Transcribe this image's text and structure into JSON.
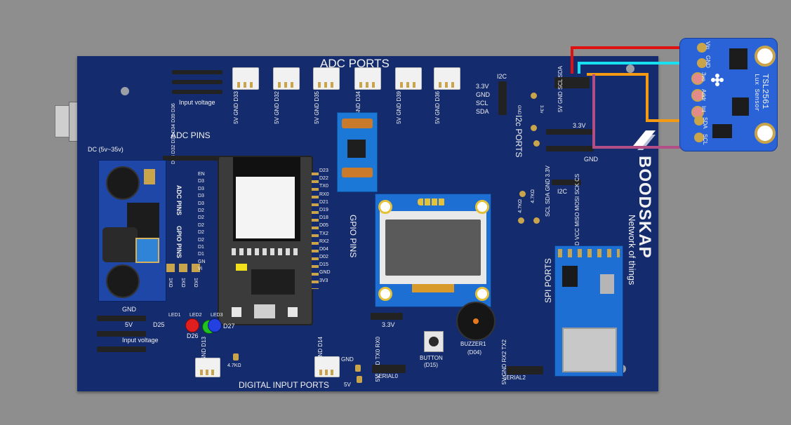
{
  "board": {
    "brand": "BOODSKAP",
    "tagline": "Network of things",
    "adc_ports_title": "ADC PORTS",
    "adc_pins_title": "ADC PINS",
    "adc_pins_side": "ADC PINS",
    "gpio_pins_title": "GPIO PINS",
    "gpio_pins_side": "GPIO PINS",
    "i2c_ports_title": "I2c PORTS",
    "spi_ports_title": "SPI PORTS",
    "digital_input_title": "DIGITAL INPUT PORTS",
    "input_voltage_top": "Input voltage",
    "input_voltage_bottom": "Input voltage",
    "dc_label": "DC (5v~35v)",
    "adc_ports": [
      {
        "labels": "5V GND D33"
      },
      {
        "labels": "5V GND D32"
      },
      {
        "labels": "5V GND D35"
      },
      {
        "labels": "5V GND D34"
      },
      {
        "labels": "5V GND D39"
      },
      {
        "labels": "5V GND D36"
      }
    ],
    "adc_pin_labels": "D33 D32 D35 D34 D39 D36",
    "esp_left_pins": [
      "EN",
      "D3",
      "D3",
      "D3",
      "D3",
      "D2",
      "D2",
      "D2",
      "D2",
      "D2",
      "D1",
      "D1",
      "GN",
      "Vi"
    ],
    "esp_right_pins": [
      "D23",
      "D22",
      "TX0",
      "RX0",
      "D21",
      "D19",
      "D18",
      "D05",
      "TX2",
      "RX2",
      "D04",
      "D02",
      "D15",
      "GND",
      "3V3"
    ],
    "i2c_left": {
      "title": "I2C",
      "pins": [
        "3.3V",
        "GND",
        "SCL",
        "SDA"
      ]
    },
    "i2c_bottom": {
      "title": "I2C",
      "pins": [
        "SCL",
        "SDA",
        "GND",
        "3.3V"
      ]
    },
    "header_33v": "3.3V",
    "header_gnd": "GND",
    "resistor_47k_a": "4.7KΩ",
    "resistor_47k_b": "4.7KΩ",
    "resistor_47k_c": "4.7KΩ",
    "leds": [
      {
        "name": "LED1",
        "pin": "D25",
        "color": "#e01e1e"
      },
      {
        "name": "LED2",
        "pin": "D26",
        "color": "#1fc21f"
      },
      {
        "name": "LED3",
        "pin": "D27",
        "color": "#2340e0"
      }
    ],
    "resistors_1k": [
      "1KΩ",
      "1KΩ",
      "1KΩ"
    ],
    "gnd_label_bottom": "GND",
    "v5_label_bottom": "5V",
    "digital_port_labels_a": "5V GND D13",
    "digital_port_labels_b": "5V GND D14",
    "digital_gnd": "GND",
    "digital_5v": "5V",
    "serial0": {
      "title": "SERIAL0",
      "pins": "5V GND TX0 RX0"
    },
    "serial2": {
      "title": "SERIAL2",
      "pins": "5V GND RX2 TX2"
    },
    "header_33v_bottom": "3.3V",
    "button": {
      "name": "BUTTON",
      "pin": "(D15)"
    },
    "buzzer": {
      "name": "BUZZER1",
      "pin": "(D04)"
    },
    "spi_labels": "GND VCC MISO MOSI SCK CS",
    "i2c_header_pins": "5V GND SCL SDA",
    "vertical_3v": "3.3v",
    "vertical_gnd": "GND"
  },
  "sensor": {
    "name": "TSL2561",
    "subtitle": "Lux Sensor",
    "pins": [
      "Vin",
      "GND",
      "3vo",
      "Addr",
      "Int",
      "SDA",
      "SCL"
    ]
  },
  "wires": {
    "vin_color": "#e01010",
    "gnd_color": "#19e0f0",
    "sda_color": "#f39a12",
    "scl_color": "#b14e86"
  },
  "colors": {
    "board": "#142b6e",
    "background": "#8e8e8e",
    "module_blue": "#1b78d6",
    "sensor_blue": "#2a63d8"
  }
}
